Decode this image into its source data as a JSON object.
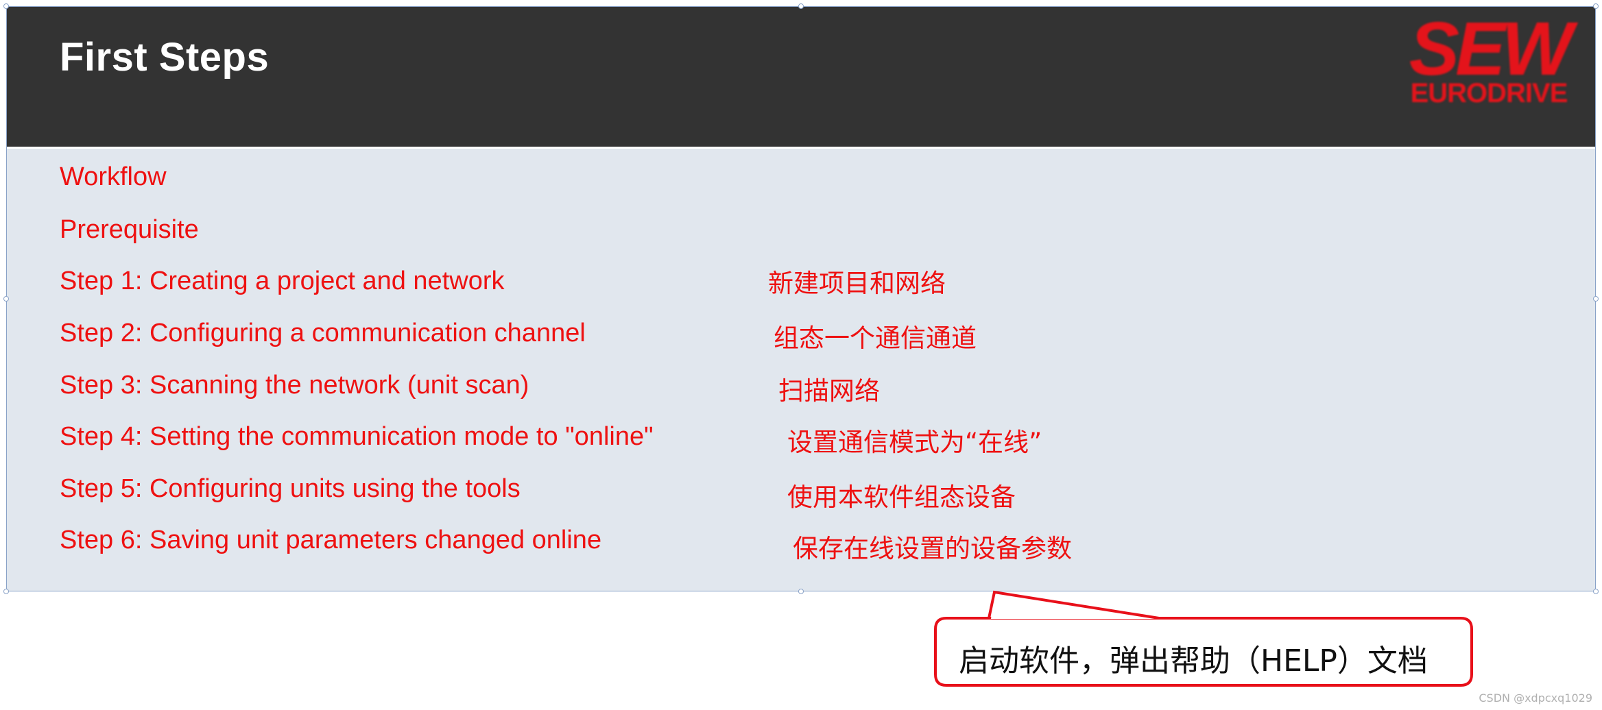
{
  "header": {
    "title": "First Steps",
    "logo_main": "SEW",
    "logo_sub": "EURODRIVE"
  },
  "links": [
    {
      "label": "Workflow",
      "note": ""
    },
    {
      "label": "Prerequisite",
      "note": ""
    },
    {
      "label": "Step 1: Creating a project and network",
      "note": "新建项目和网络"
    },
    {
      "label": "Step 2: Configuring a communication channel",
      "note": "组态一个通信通道"
    },
    {
      "label": "Step 3: Scanning the network (unit scan)",
      "note": "扫描网络"
    },
    {
      "label": "Step 4: Setting the communication mode to \"online\"",
      "note": "设置通信模式为“在线”"
    },
    {
      "label": "Step 5: Configuring units using the tools",
      "note": "使用本软件组态设备"
    },
    {
      "label": "Step 6: Saving unit parameters changed online",
      "note": "保存在线设置的设备参数"
    }
  ],
  "callout": {
    "text": "启动软件，弹出帮助（HELP）文档"
  },
  "watermark": "CSDN @xdpcxq1029",
  "colors": {
    "header_bg": "#333333",
    "panel_bg": "#e1e7ee",
    "link_red": "#ee1111",
    "logo_red": "#e4141b",
    "callout_border": "#e8101a"
  }
}
